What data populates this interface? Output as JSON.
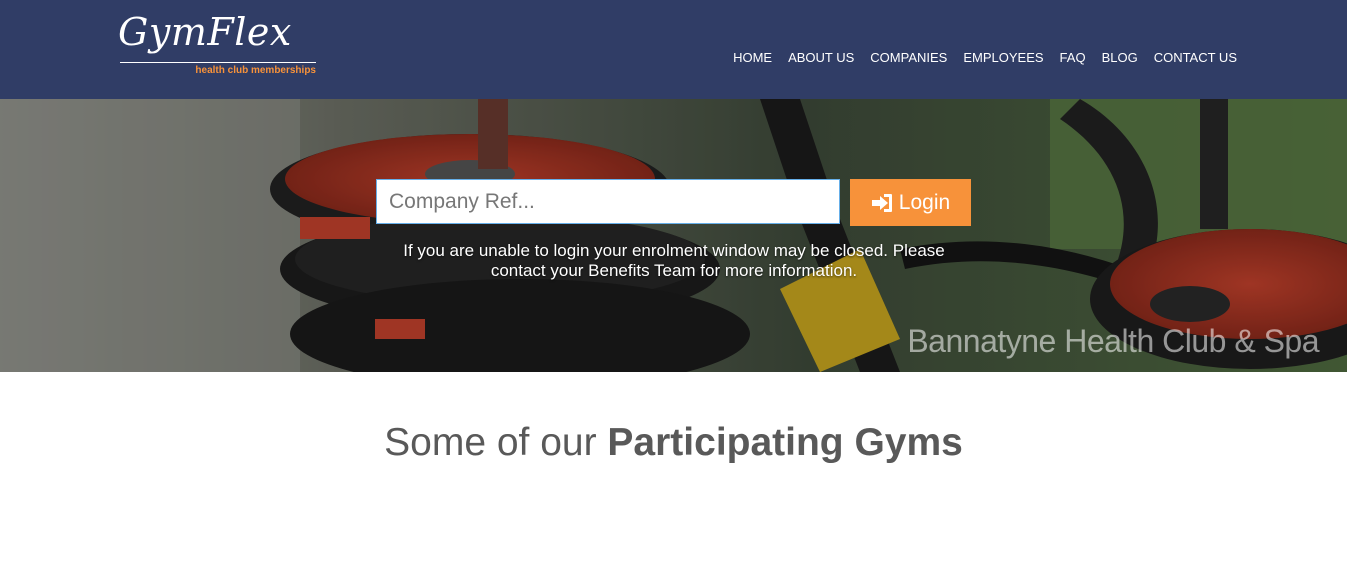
{
  "brand": {
    "name": "GymFlex",
    "tagline": "health club memberships",
    "primary_color": "#303d66",
    "accent_color": "#f7923a"
  },
  "nav": {
    "items": [
      {
        "label": "HOME"
      },
      {
        "label": "ABOUT US"
      },
      {
        "label": "COMPANIES"
      },
      {
        "label": "EMPLOYEES"
      },
      {
        "label": "FAQ"
      },
      {
        "label": "BLOG"
      },
      {
        "label": "CONTACT US"
      }
    ]
  },
  "hero": {
    "company_ref": {
      "placeholder": "Company Ref...",
      "value": ""
    },
    "login_button": {
      "label": "Login",
      "icon": "sign-in-icon"
    },
    "notice": "If you are unable to login your enrolment window may be closed. Please contact your Benefits Team for more information.",
    "caption": "Bannatyne Health Club & Spa"
  },
  "section": {
    "title_prefix": "Some of our ",
    "title_emphasis": "Participating Gyms"
  }
}
